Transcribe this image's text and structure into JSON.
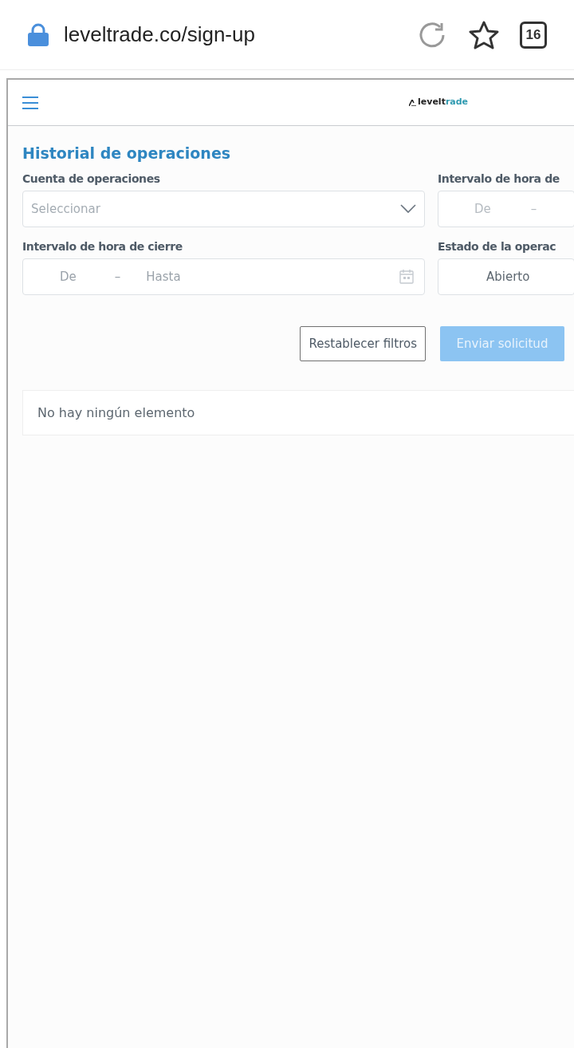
{
  "browser": {
    "url": "leveltrade.co/sign-up",
    "tab_count": "16"
  },
  "header": {
    "logo_text": "levelt",
    "logo_accent": "rade"
  },
  "page": {
    "title": "Historial de operaciones",
    "filters": [
      {
        "kind": "select",
        "label": "Cuenta de operaciones",
        "placeholder": "Seleccionar"
      },
      {
        "kind": "range",
        "label": "Intervalo de hora de",
        "from": "De",
        "dash": "–"
      },
      {
        "kind": "range_calendar",
        "label": "Intervalo de hora de cierre",
        "from": "De",
        "dash": "–",
        "to": "Hasta"
      },
      {
        "kind": "value",
        "label": "Estado de la operac",
        "value": "Abierto"
      }
    ],
    "buttons": [
      {
        "label": "Restablecer filtros",
        "kind": "outline",
        "disabled": false
      },
      {
        "label": "Enviar solicitud",
        "kind": "primary",
        "disabled": true
      }
    ],
    "empty_message": "No hay ningún elemento"
  }
}
